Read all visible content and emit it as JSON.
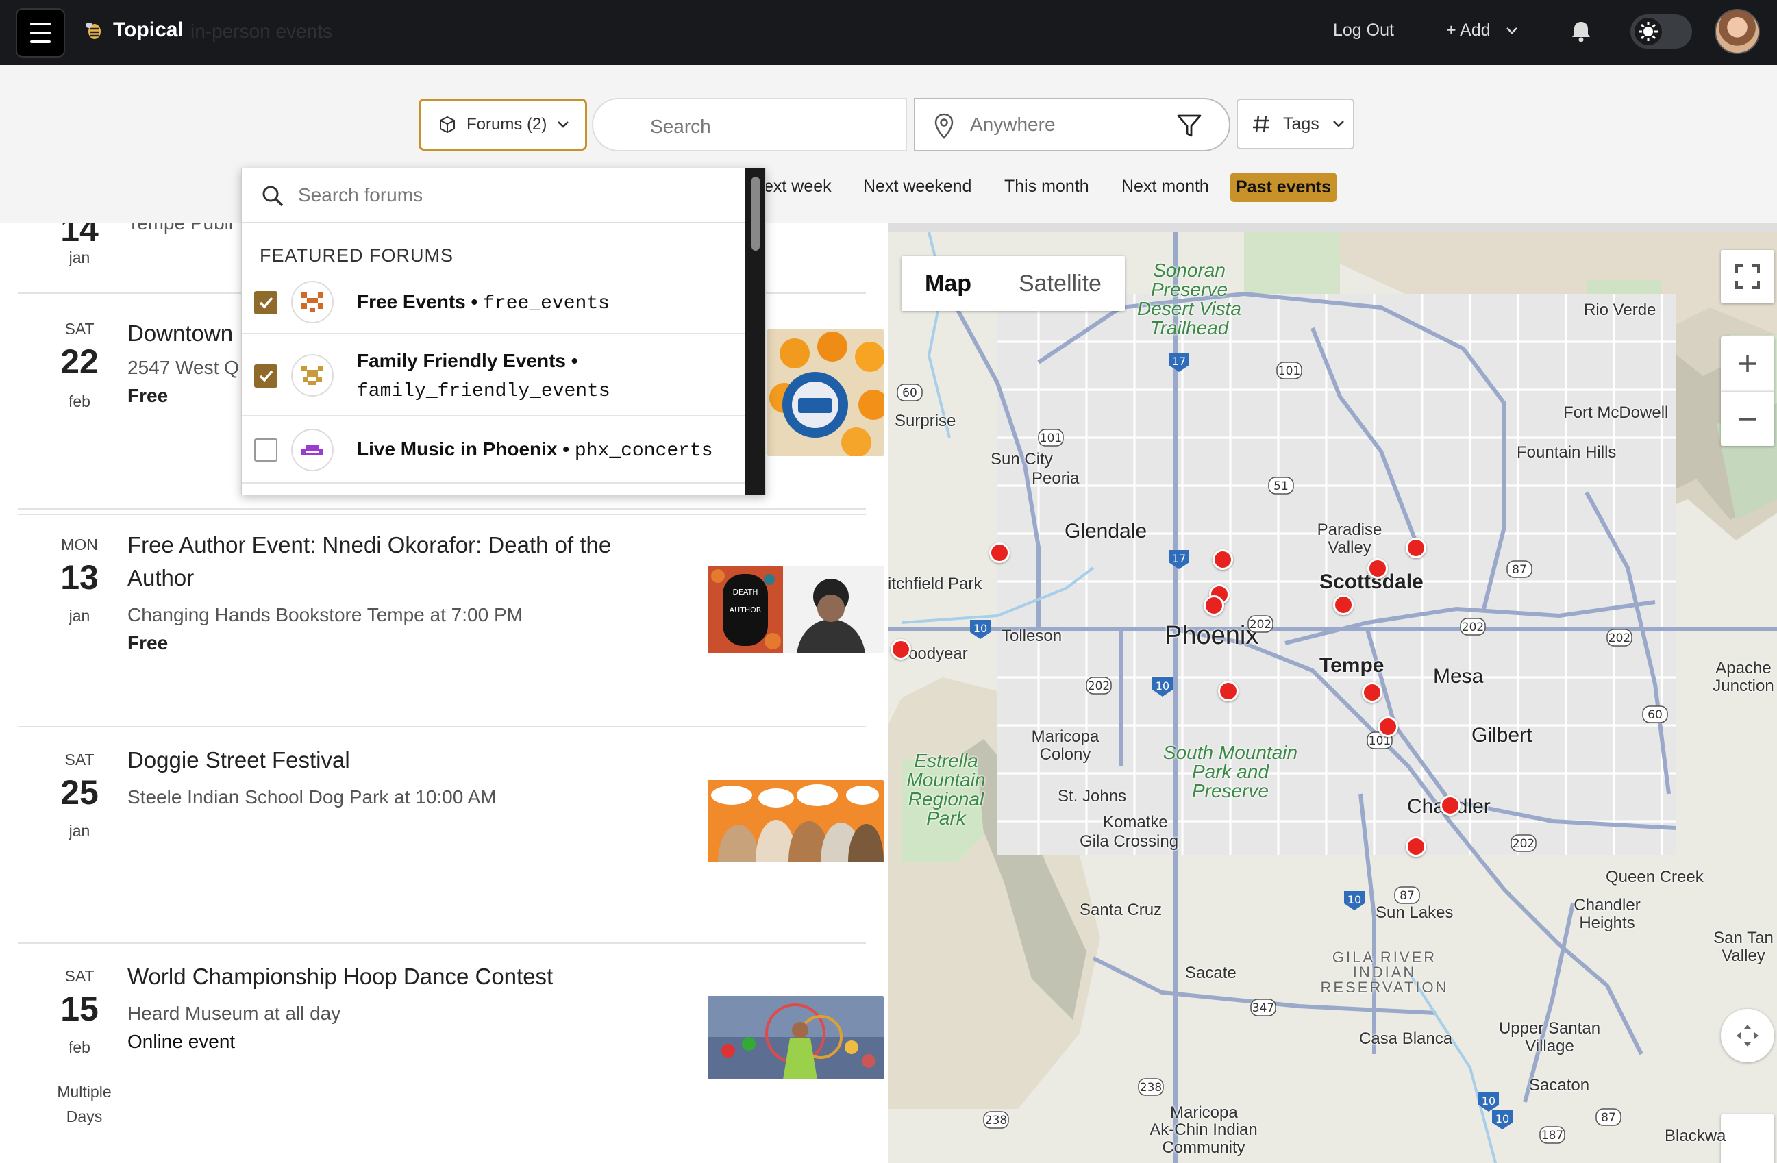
{
  "topbar": {
    "brand": "Topical",
    "subtitle": "in-person events",
    "logout": "Log Out",
    "add": "+ Add"
  },
  "filters": {
    "forums_label": "Forums (2)",
    "search_placeholder": "Search",
    "location_placeholder": "Anywhere",
    "tags_label": "Tags",
    "quick": [
      "ext week",
      "Next weekend",
      "This month",
      "Next month",
      "Past events"
    ],
    "active_quick": "Past events"
  },
  "dropdown": {
    "search_placeholder": "Search forums",
    "header": "FEATURED FORUMS",
    "forums": [
      {
        "name": "Free Events",
        "slug": "free_events",
        "checked": true
      },
      {
        "name": "Family Friendly Events",
        "slug": "family_friendly_events",
        "checked": true
      },
      {
        "name": "Live Music in Phoenix",
        "slug": "phx_concerts",
        "checked": false
      }
    ]
  },
  "events": [
    {
      "dow": "",
      "day": "14",
      "mon": "jan",
      "title": "",
      "place": "Tempe Publi",
      "price": ""
    },
    {
      "dow": "SAT",
      "day": "22",
      "mon": "feb",
      "title": "Downtown",
      "place": "2547 West Q",
      "price": "Free"
    },
    {
      "dow": "MON",
      "day": "13",
      "mon": "jan",
      "title": "Free Author Event: Nnedi Okorafor: Death of the Author",
      "place": "Changing Hands Bookstore Tempe at 7:00 PM",
      "price": "Free"
    },
    {
      "dow": "SAT",
      "day": "25",
      "mon": "jan",
      "title": "Doggie Street Festival",
      "place": "Steele Indian School Dog Park at 10:00 AM",
      "price": ""
    },
    {
      "dow": "SAT",
      "day": "15",
      "mon": "feb",
      "title": "World Championship Hoop Dance Contest",
      "place": "Heard Museum at all day",
      "price": "Online event",
      "extra": "Multiple Days"
    }
  ],
  "map": {
    "types": [
      "Map",
      "Satellite"
    ],
    "labels": {
      "sonoran": "Sonoran Preserve Desert Vista Trailhead",
      "rio_verde": "Rio Verde",
      "fort_mcdowell": "Fort McDowell",
      "fountain_hills": "Fountain Hills",
      "surprise": "Surprise",
      "sun_city": "Sun City",
      "peoria": "Peoria",
      "glendale": "Glendale",
      "paradise_valley": "Paradise Valley",
      "scottsdale": "Scottsdale",
      "litchfield": "itchfield Park",
      "tolleson": "Tolleson",
      "phoenix": "Phoenix",
      "goodyear": "oodyear",
      "tempe": "Tempe",
      "mesa": "Mesa",
      "apache": "Apache Junction",
      "maricopa_colony": "Maricopa Colony",
      "estrella": "Estrella Mountain Regional Park",
      "south_mountain": "South Mountain Park and Preserve",
      "gilbert": "Gilbert",
      "st_johns": "St. Johns",
      "komatke": "Komatke",
      "gila_crossing": "Gila Crossing",
      "chandler": "Chandler",
      "queen_creek": "Queen Creek",
      "chandler_heights": "Chandler Heights",
      "santa_cruz": "Santa Cruz",
      "sun_lakes": "Sun Lakes",
      "san_tan": "San Tan Valley",
      "sacate": "Sacate",
      "gila_river": "GILA RIVER INDIAN RESERVATION",
      "casa_blanca": "Casa Blanca",
      "upper_santan": "Upper Santan Village",
      "sacaton": "Sacaton",
      "maricopa": "Maricopa",
      "ak_chin": "Ak-Chin Indian Community",
      "blackwater": "Blackwa"
    },
    "highway_shields": [
      "60",
      "101",
      "17",
      "101",
      "51",
      "87",
      "10",
      "202",
      "202",
      "202",
      "202",
      "10",
      "60",
      "101",
      "202",
      "10",
      "87",
      "347",
      "238",
      "238",
      "10",
      "10",
      "87",
      "187",
      "17"
    ]
  }
}
